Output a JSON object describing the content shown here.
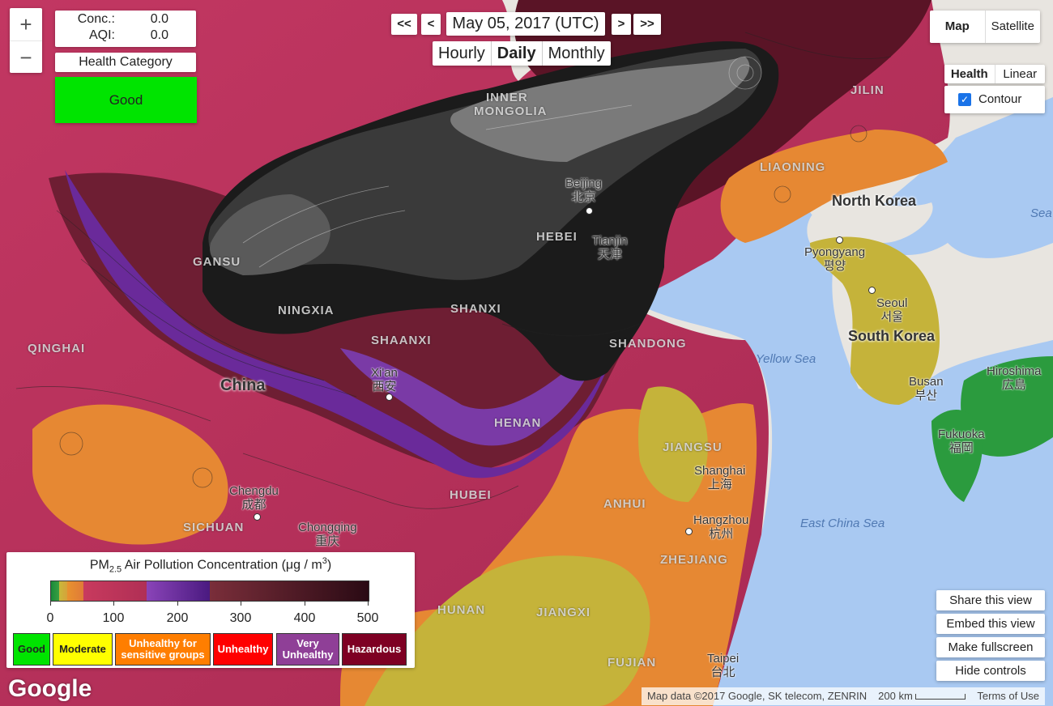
{
  "readout": {
    "conc_label": "Conc.:",
    "conc_value": "0.0",
    "aqi_label": "AQI:",
    "aqi_value": "0.0"
  },
  "zoom": {
    "in": "+",
    "out": "−"
  },
  "health_category": {
    "label": "Health Category",
    "value": "Good",
    "value_color": "#00e400"
  },
  "date_nav": {
    "first": "<<",
    "prev": "<",
    "date": "May 05, 2017 (UTC)",
    "next": ">",
    "last": ">>"
  },
  "period": {
    "options": [
      "Hourly",
      "Daily",
      "Monthly"
    ],
    "selected": "Daily"
  },
  "map_type": {
    "options": [
      "Map",
      "Satellite"
    ],
    "selected": "Map"
  },
  "scale_type": {
    "options": [
      "Health",
      "Linear"
    ],
    "selected": "Health"
  },
  "contour": {
    "label": "Contour",
    "checked": true
  },
  "legend": {
    "title_prefix": "PM",
    "title_sub": "2.5",
    "title_main": " Air Pollution Concentration (μg / m",
    "title_sup": "3",
    "title_suffix": ")",
    "ticks": [
      "0",
      "100",
      "200",
      "300",
      "400",
      "500"
    ],
    "categories": [
      {
        "label": "Good",
        "color": "#00e400",
        "text_color": "#222222"
      },
      {
        "label": "Moderate",
        "color": "#ffff00",
        "text_color": "#222222"
      },
      {
        "label": "Unhealthy for sensitive groups",
        "color": "#ff7e00",
        "text_color": "#ffffff"
      },
      {
        "label": "Unhealthy",
        "color": "#ff0000",
        "text_color": "#ffffff"
      },
      {
        "label": "Very Unhealthy",
        "color": "#8f3f97",
        "text_color": "#ffffff"
      },
      {
        "label": "Hazardous",
        "color": "#7e0023",
        "text_color": "#ffffff"
      }
    ]
  },
  "right_buttons": [
    "Share this view",
    "Embed this view",
    "Make fullscreen",
    "Hide controls"
  ],
  "attribution": {
    "map_data": "Map data ©2017 Google, SK telecom, ZENRIN",
    "scale": "200 km",
    "terms": "Terms of Use"
  },
  "google_logo": "Google",
  "map_labels": {
    "provinces": [
      "INNER",
      "MONGOLIA",
      "JILIN",
      "LIAONING",
      "GANSU",
      "NINGXIA",
      "SHANXI",
      "HEBEI",
      "SHAANXI",
      "SHANDONG",
      "QINGHAI",
      "HENAN",
      "JIANGSU",
      "HUBEI",
      "ANHUI",
      "SICHUAN",
      "ZHEJIANG",
      "HUNAN",
      "JIANGXI",
      "FUJIAN"
    ],
    "cities": {
      "beijing": [
        "Beijing",
        "北京"
      ],
      "tianjin": [
        "Tianjin",
        "天津"
      ],
      "xian": [
        "Xi'an",
        "西安"
      ],
      "chengdu": [
        "Chengdu",
        "成都"
      ],
      "chongqing": [
        "Chongqing",
        "重庆"
      ],
      "shanghai": [
        "Shanghai",
        "上海"
      ],
      "hangzhou": [
        "Hangzhou",
        "杭州"
      ],
      "taipei": [
        "Taipei",
        "台北"
      ],
      "pyongyang": [
        "Pyongyang",
        "평양"
      ],
      "seoul": [
        "Seoul",
        "서울"
      ],
      "busan": [
        "Busan",
        "부산"
      ],
      "hiroshima": [
        "Hiroshima",
        "広島"
      ],
      "fukuoka": [
        "Fukuoka",
        "福岡"
      ]
    },
    "countries": [
      "China",
      "North Korea",
      "South Korea"
    ],
    "seas": [
      "Yellow Sea",
      "East China Sea",
      "Sea"
    ]
  }
}
